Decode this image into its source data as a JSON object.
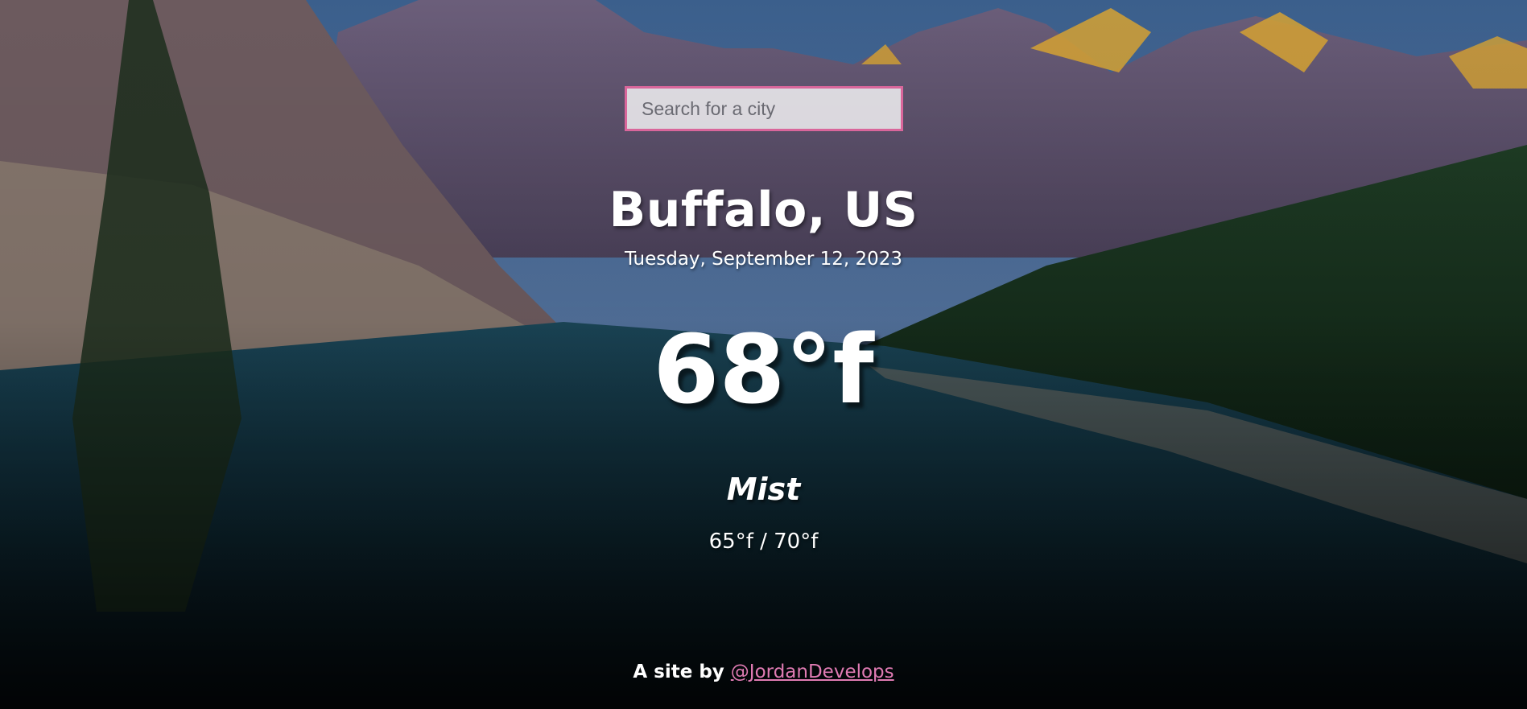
{
  "search": {
    "placeholder": "Search for a city"
  },
  "location": {
    "city": "Buffalo, US",
    "date": "Tuesday, September 12, 2023"
  },
  "weather": {
    "temperature": "68°f",
    "condition": "Mist",
    "range": "65°f / 70°f"
  },
  "footer": {
    "prefix": "A site by ",
    "link_text": "@JordanDevelops"
  },
  "colors": {
    "accent": "#d9669b",
    "link": "#e07bb3"
  }
}
